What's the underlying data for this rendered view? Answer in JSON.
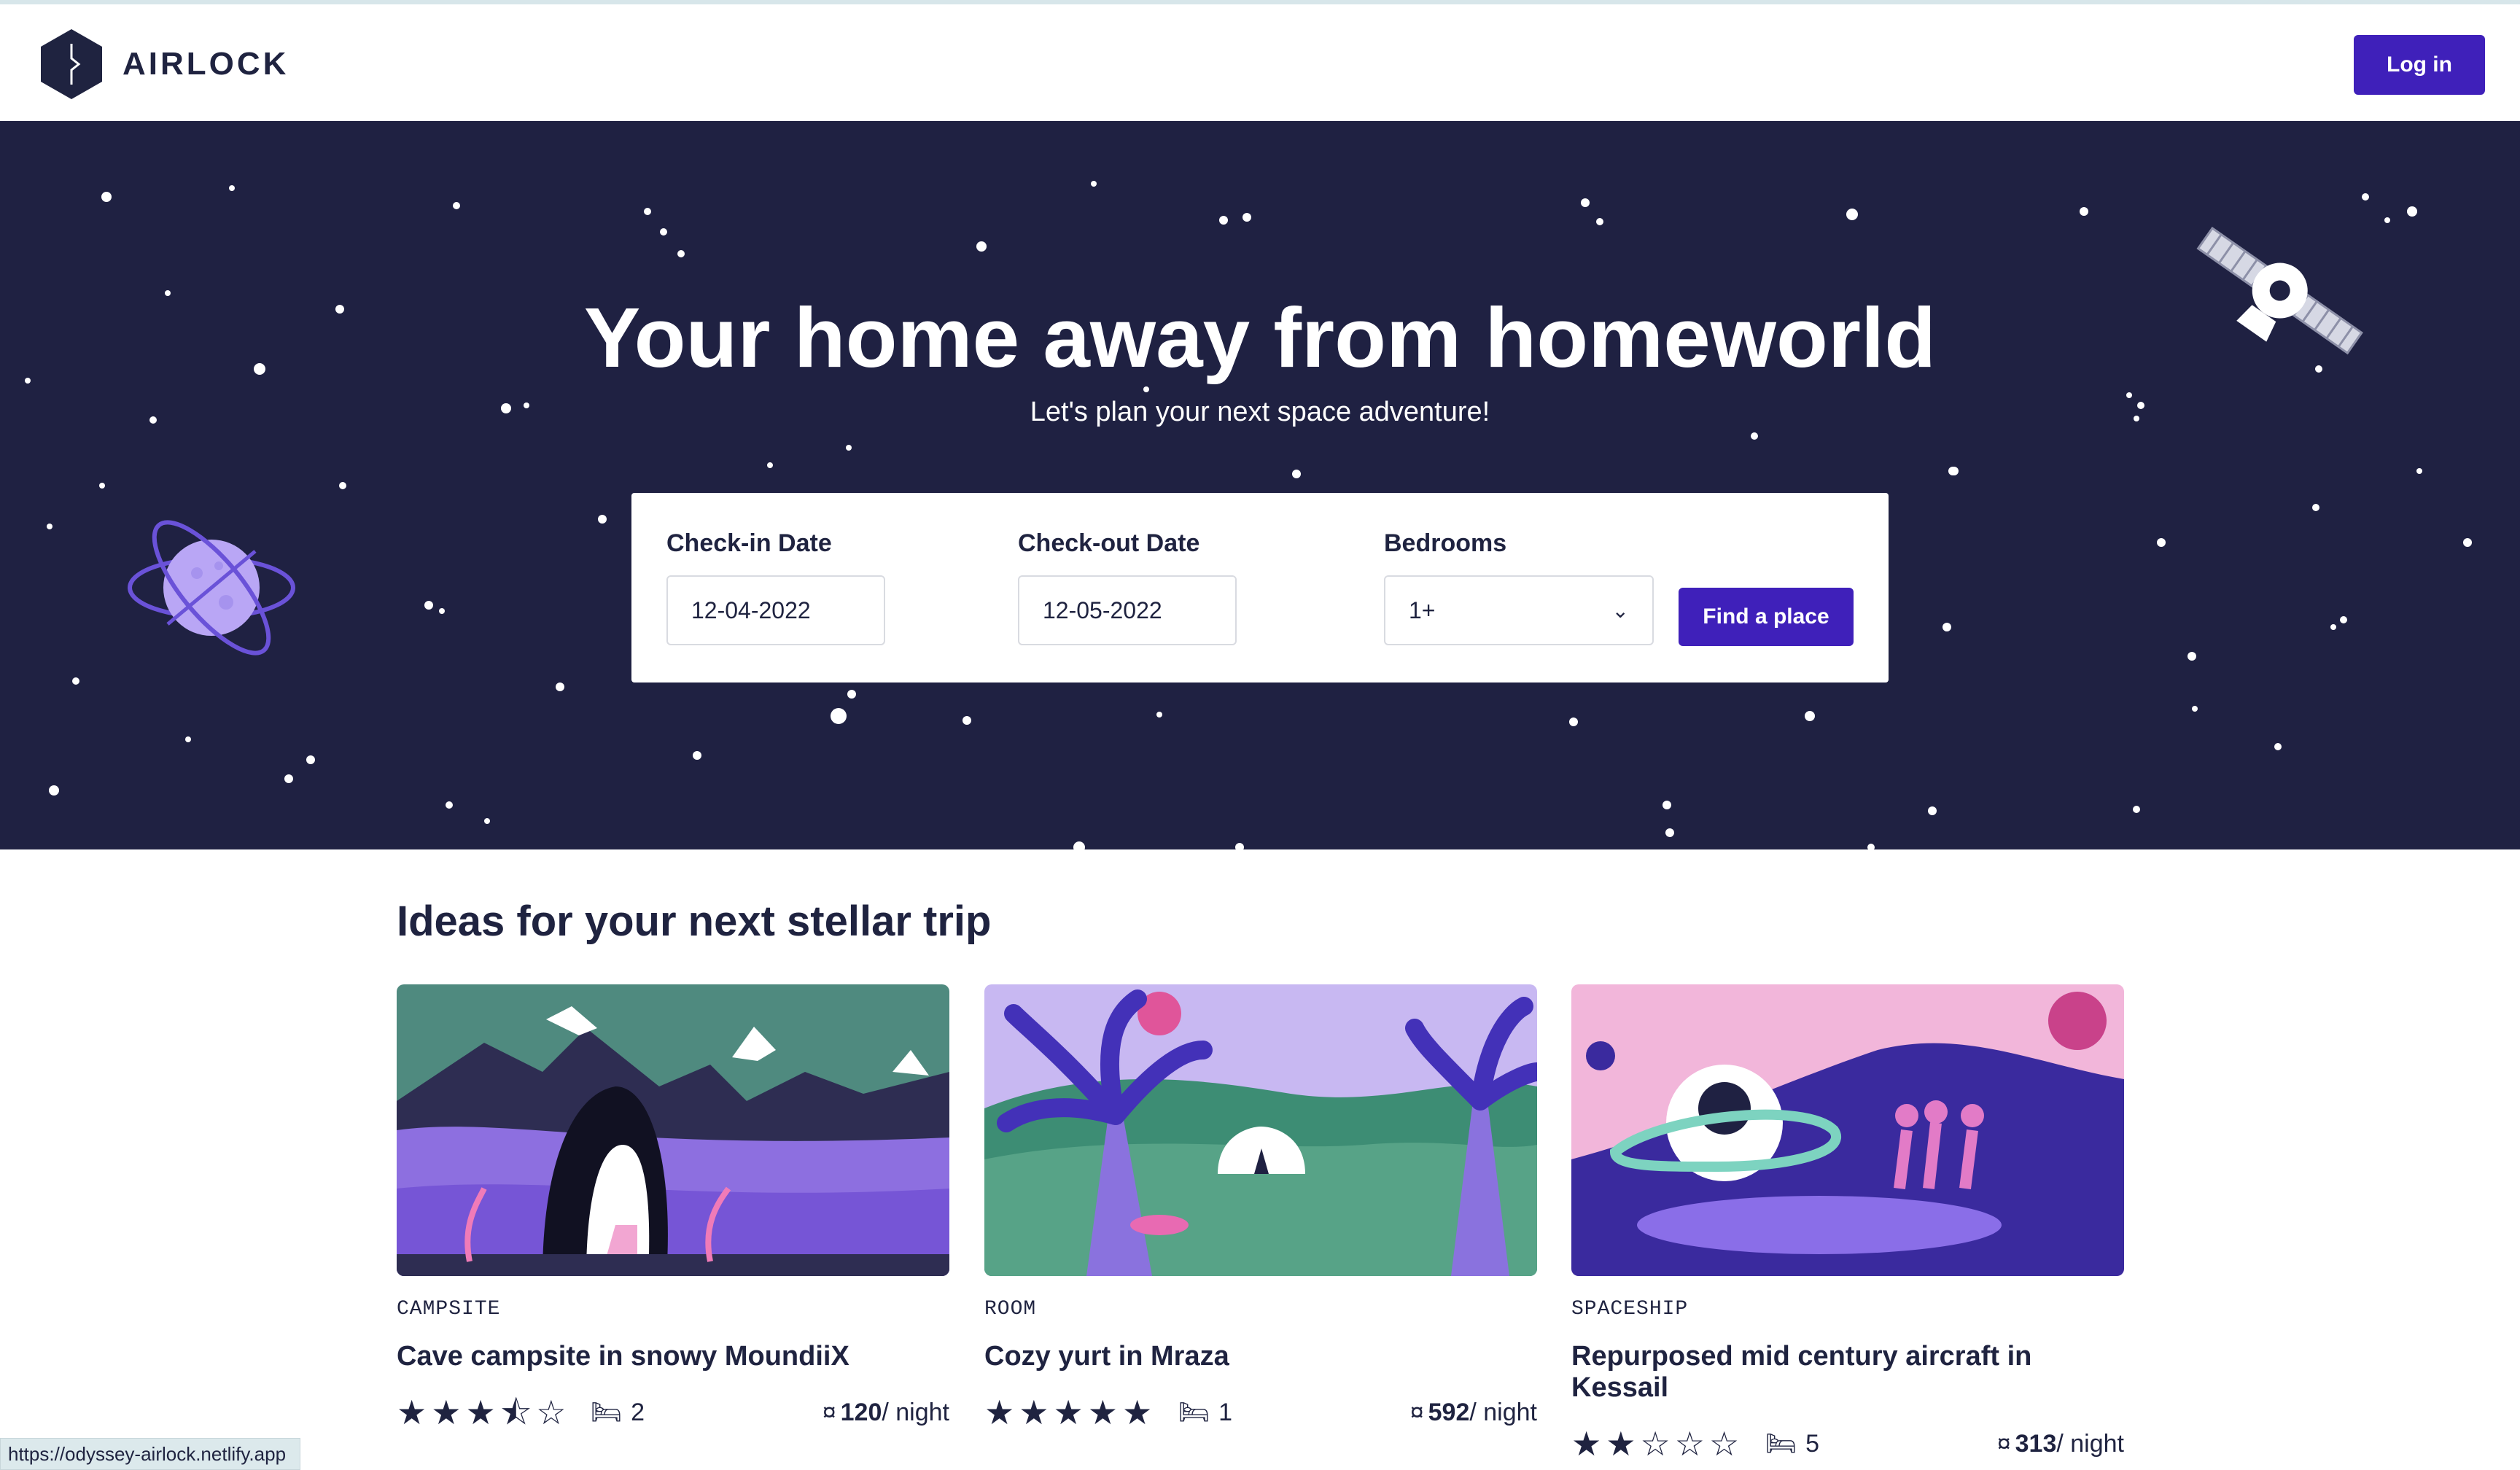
{
  "nav": {
    "brand": "AIRLOCK",
    "login_label": "Log in"
  },
  "hero": {
    "title": "Your home away from homeworld",
    "subtitle": "Let's plan your next space adventure!"
  },
  "search": {
    "checkin_label": "Check-in Date",
    "checkin_value": "12-04-2022",
    "checkout_label": "Check-out Date",
    "checkout_value": "12-05-2022",
    "bedrooms_label": "Bedrooms",
    "bedrooms_value": "1+",
    "find_label": "Find a place"
  },
  "listings": {
    "heading": "Ideas for your next stellar trip",
    "items": [
      {
        "type": "CAMPSITE",
        "title": "Cave campsite in snowy MoundiiX",
        "rating": 3.5,
        "stars": "★★★⯪☆",
        "beds": "2",
        "currency": "¤",
        "price": "120",
        "unit": "/ night"
      },
      {
        "type": "ROOM",
        "title": "Cozy yurt in Mraza",
        "rating": 5,
        "stars": "★★★★★",
        "beds": "1",
        "currency": "¤",
        "price": "592",
        "unit": "/ night"
      },
      {
        "type": "SPACESHIP",
        "title": "Repurposed mid century aircraft in Kessail",
        "rating": 2,
        "stars": "★★☆☆☆",
        "beds": "5",
        "currency": "¤",
        "price": "313",
        "unit": "/ night"
      }
    ]
  },
  "status_url": "https://odyssey-airlock.netlify.app",
  "colors": {
    "accent": "#3f20ba",
    "hero_bg": "#1f2142",
    "text": "#1f2340"
  }
}
